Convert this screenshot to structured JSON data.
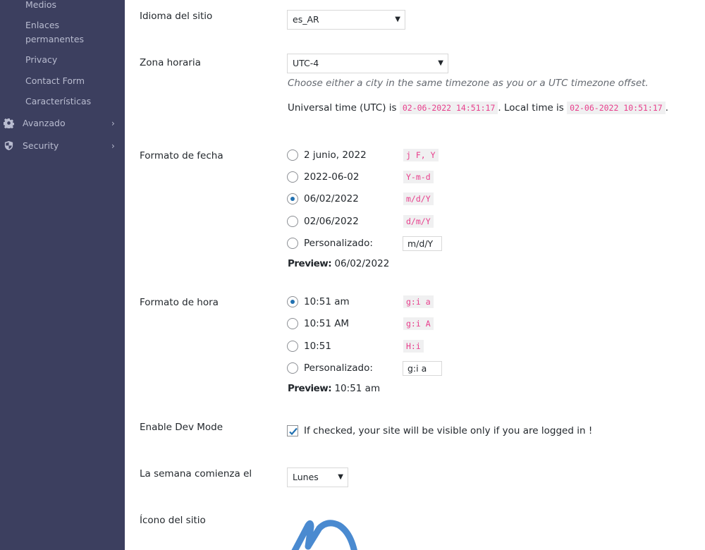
{
  "sidebar": {
    "sub_items": [
      {
        "label": "Medios"
      },
      {
        "label": "Enlaces permanentes"
      },
      {
        "label": "Privacy"
      },
      {
        "label": "Contact Form"
      },
      {
        "label": "Características"
      }
    ],
    "top_items": [
      {
        "label": "Avanzado",
        "icon": "gear-icon"
      },
      {
        "label": "Security",
        "icon": "shield-icon"
      }
    ]
  },
  "settings": {
    "site_language": {
      "label": "Idioma del sitio",
      "value": "es_AR"
    },
    "timezone": {
      "label": "Zona horaria",
      "value": "UTC-4",
      "description": "Choose either a city in the same timezone as you or a UTC timezone offset.",
      "utc_prefix": "Universal time (UTC) is",
      "utc_time": "02-06-2022 14:51:17",
      "local_prefix": ". Local time is",
      "local_time": "02-06-2022 10:51:17",
      "suffix": "."
    },
    "date_format": {
      "label": "Formato de fecha",
      "options": [
        {
          "text": "2 junio, 2022",
          "code": "j F, Y",
          "checked": false
        },
        {
          "text": "2022-06-02",
          "code": "Y-m-d",
          "checked": false
        },
        {
          "text": "06/02/2022",
          "code": "m/d/Y",
          "checked": true
        },
        {
          "text": "02/06/2022",
          "code": "d/m/Y",
          "checked": false
        }
      ],
      "custom_label": "Personalizado:",
      "custom_value": "m/d/Y",
      "preview_label": "Preview:",
      "preview_value": "06/02/2022"
    },
    "time_format": {
      "label": "Formato de hora",
      "options": [
        {
          "text": "10:51 am",
          "code": "g:i a",
          "checked": true
        },
        {
          "text": "10:51 AM",
          "code": "g:i A",
          "checked": false
        },
        {
          "text": "10:51",
          "code": "H:i",
          "checked": false
        }
      ],
      "custom_label": "Personalizado:",
      "custom_value": "g:i a",
      "preview_label": "Preview:",
      "preview_value": "10:51 am"
    },
    "dev_mode": {
      "label": "Enable Dev Mode",
      "checked": true,
      "text": "If checked, your site will be visible only if you are logged in !"
    },
    "week_start": {
      "label": "La semana comienza el",
      "value": "Lunes"
    },
    "site_icon": {
      "label": "Ícono del sitio"
    }
  },
  "colors": {
    "sidebar_bg": "#3c3f5f",
    "accent": "#2271b1",
    "code_pink": "#e83e8c",
    "site_icon_blue": "#4a8ad0"
  }
}
